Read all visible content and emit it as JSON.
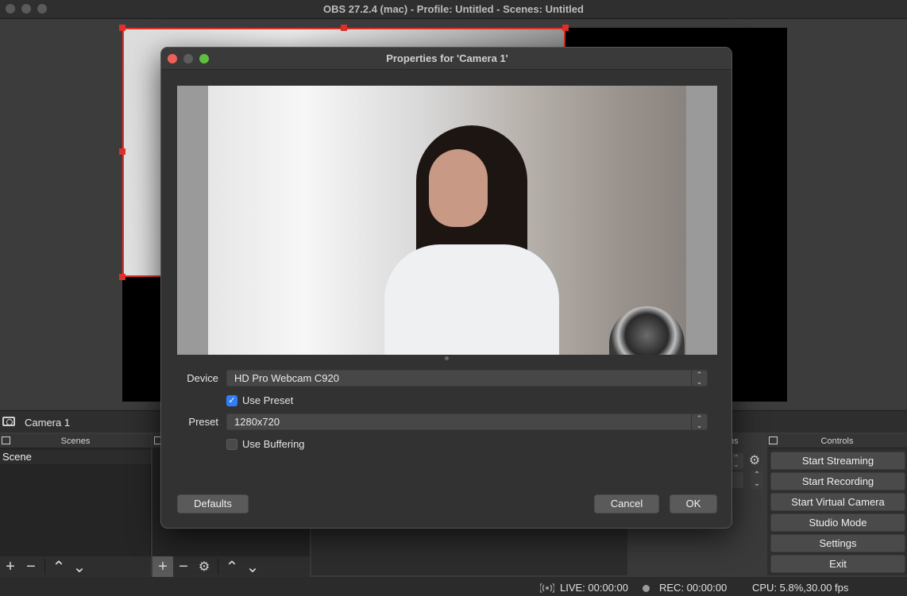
{
  "window": {
    "title": "OBS 27.2.4 (mac) - Profile: Untitled - Scenes: Untitled"
  },
  "source_bar": {
    "label": "Camera 1"
  },
  "docks": {
    "scenes_header": "Scenes",
    "controls_header": "Controls",
    "transitions_header_fragment": "ns"
  },
  "scenes": {
    "items": [
      "Scene"
    ]
  },
  "controls": {
    "buttons": [
      "Start Streaming",
      "Start Recording",
      "Start Virtual Camera",
      "Studio Mode",
      "Settings",
      "Exit"
    ]
  },
  "toolbar": {
    "add": "+",
    "remove": "−",
    "up": "⌃",
    "down": "⌄"
  },
  "status": {
    "live": "LIVE: 00:00:00",
    "rec": "REC: 00:00:00",
    "cpu": "CPU: 5.8%,30.00 fps"
  },
  "dialog": {
    "title": "Properties for 'Camera 1'",
    "device_label": "Device",
    "device_value": "HD Pro Webcam C920",
    "use_preset_label": "Use Preset",
    "use_preset_checked": true,
    "preset_label": "Preset",
    "preset_value": "1280x720",
    "use_buffering_label": "Use Buffering",
    "use_buffering_checked": false,
    "defaults_button": "Defaults",
    "cancel_button": "Cancel",
    "ok_button": "OK"
  },
  "colors": {
    "selection_red": "#e0302b",
    "checkbox_blue": "#2f7ef6",
    "close_red": "#ee5f57",
    "zoom_green": "#5fc03f"
  }
}
